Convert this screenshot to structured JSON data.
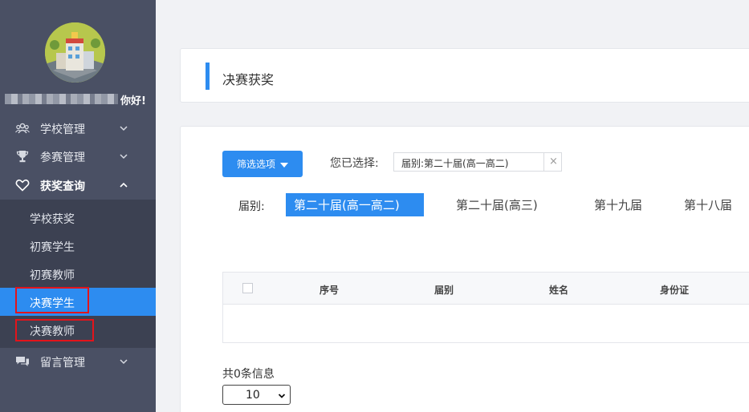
{
  "user": {
    "greeting": "你好!"
  },
  "sidebar": {
    "menus": [
      {
        "label": "学校管理",
        "icon": "users-icon"
      },
      {
        "label": "参赛管理",
        "icon": "trophy-icon"
      },
      {
        "label": "获奖查询",
        "icon": "heart-icon"
      },
      {
        "label": "留言管理",
        "icon": "chat-icon"
      }
    ],
    "submenu": [
      {
        "label": "学校获奖"
      },
      {
        "label": "初赛学生"
      },
      {
        "label": "初赛教师"
      },
      {
        "label": "决赛学生"
      },
      {
        "label": "决赛教师"
      }
    ]
  },
  "page": {
    "title": "决赛获奖"
  },
  "filter": {
    "button_label": "筛选选项",
    "selected_label": "您已选择:",
    "chip_text": "届别:第二十届(高一高二)",
    "chip_close": "×",
    "row_label": "届别:",
    "options": [
      "第二十届(高一高二)",
      "第二十届(高三)",
      "第十九届",
      "第十八届"
    ]
  },
  "table": {
    "columns": [
      "序号",
      "届别",
      "姓名",
      "身份证"
    ]
  },
  "footer": {
    "count_text": "共0条信息",
    "page_size": "10"
  },
  "colors": {
    "accent": "#2d8cf0",
    "sidebar": "#4a5064",
    "highlight": "#e3141b"
  }
}
